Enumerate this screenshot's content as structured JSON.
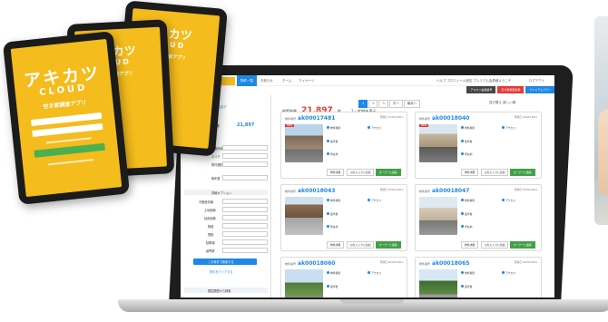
{
  "tablet_app": {
    "logo_jp": "アキカツ",
    "logo_en": "CLOUD",
    "subtitle": "空き家調査アプリ",
    "logo_jp_back": "キカツ",
    "logo_en_back": "OUD",
    "subtitle_back": "家調査アプリ",
    "accent": "#f4bc1c"
  },
  "web_app": {
    "nav": {
      "items": [
        "物件一覧",
        "お知らせ",
        "ホーム",
        "マイページ"
      ],
      "right": "ヘルプ  プロフィール設定  プレミアム会員様ようこそ",
      "logout": "ログアウト"
    },
    "subbar": {
      "dark": "アキカツ会員番号",
      "red": "空き家調査依頼",
      "blue": "プレミアムプラン"
    },
    "sidebar": {
      "search_title": "物件を検索",
      "search_link": "空き家を探す・エリアから探す",
      "count_label": "検索結果",
      "count": "21,897",
      "count_unit": "件",
      "filters": [
        {
          "label": "調査地域"
        },
        {
          "label": "エリア"
        },
        {
          "label": "物件種別"
        },
        {
          "label": "築年数"
        }
      ],
      "detail_head": "詳細オプション",
      "detail_filters": [
        {
          "label": "不動産情報"
        },
        {
          "label": "土地面積"
        },
        {
          "label": "延床面積"
        },
        {
          "label": "構造"
        },
        {
          "label": "間取"
        },
        {
          "label": "駐車場"
        },
        {
          "label": "最寄駅"
        }
      ],
      "search_button": "この条件で検索する",
      "save_link": "条件をクリアする",
      "history_head": "閲覧履歴から検索"
    },
    "results": {
      "count_label": "検索結果",
      "count": "21,897",
      "count_unit": "件",
      "range": "1 - 40件を表示",
      "pages": [
        "1",
        "2",
        "3",
        "次へ",
        "最後へ"
      ],
      "sort": "並び替え  新しい順",
      "cards": [
        {
          "id": "ak00017481",
          "date": "登録日 2018/10/01"
        },
        {
          "id": "ak00018040",
          "date": "登録日 2018/10/01"
        },
        {
          "id": "ak00018043",
          "date": "登録日 2018/10/01"
        },
        {
          "id": "ak00018047",
          "date": "登録日 2018/10/01"
        },
        {
          "id": "ak00018060",
          "date": "登録日 2018/10/01"
        },
        {
          "id": "ak00018065",
          "date": "登録日 2018/10/01"
        }
      ],
      "card_labels": {
        "prefix": "物件番号",
        "new_tag": "NEW",
        "attr1": "物件種別",
        "attr2": "アクセス",
        "attr3": "築年数",
        "attr4": "所在地",
        "btn_detail": "物件詳細",
        "btn_fav": "お気に入りに追加",
        "btn_contact": "オーナーに連絡"
      }
    }
  }
}
